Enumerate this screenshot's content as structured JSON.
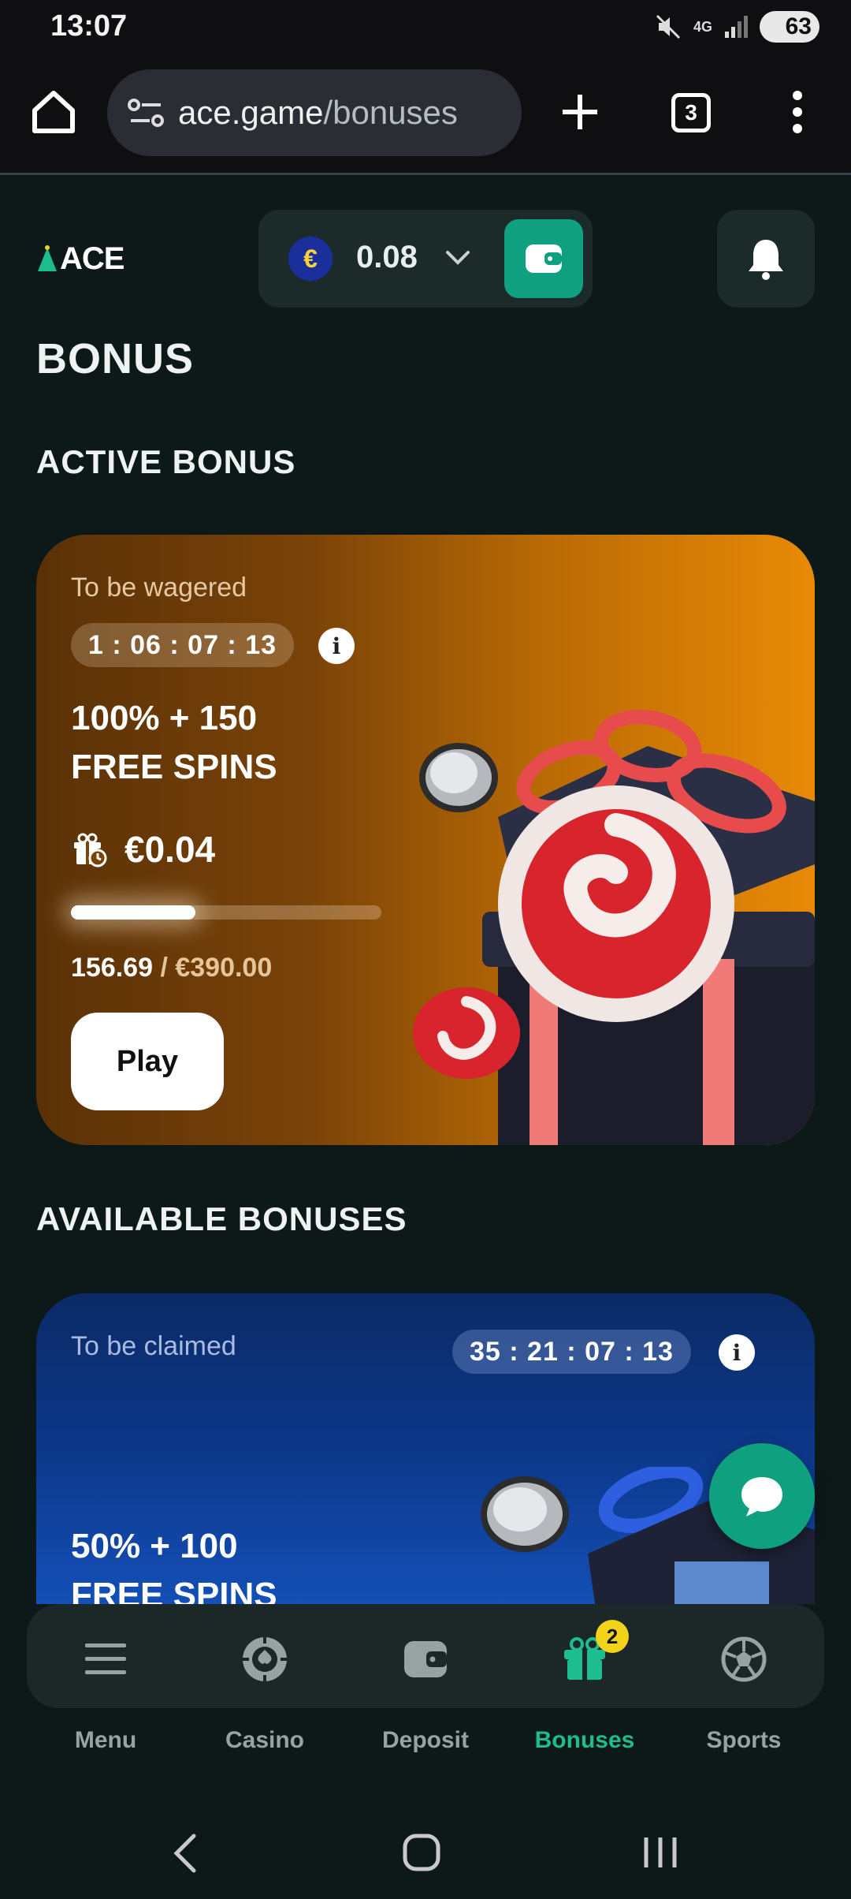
{
  "status_bar": {
    "time": "13:07",
    "network": "4G",
    "battery": "63"
  },
  "browser": {
    "url_host": "ace.game",
    "url_path": "/bonuses",
    "tab_count": "3"
  },
  "header": {
    "logo_text": "ACE",
    "currency_symbol": "€",
    "balance": "0.08"
  },
  "page": {
    "title": "BONUS",
    "active_heading": "ACTIVE BONUS",
    "available_heading": "AVAILABLE BONUSES"
  },
  "active_bonus": {
    "label": "To be wagered",
    "timer": "1 : 06 : 07 : 13",
    "title_line1": "100% + 150",
    "title_line2": "FREE SPINS",
    "amount": "€0.04",
    "progress_current": "156.69",
    "progress_total": " / €390.00",
    "progress_fraction": 0.402,
    "play_label": "Play"
  },
  "available_bonus": {
    "label": "To be claimed",
    "timer": "35 : 21 : 07 : 13",
    "title_line1": "50% + 100",
    "title_line2": "FREE SPINS"
  },
  "bottom_nav": {
    "items": [
      {
        "label": "Menu",
        "icon": "menu-icon"
      },
      {
        "label": "Casino",
        "icon": "casino-chip-icon"
      },
      {
        "label": "Deposit",
        "icon": "wallet-icon"
      },
      {
        "label": "Bonuses",
        "icon": "gift-icon",
        "badge": "2"
      },
      {
        "label": "Sports",
        "icon": "soccer-ball-icon"
      }
    ]
  },
  "colors": {
    "accent_green": "#0fa07f",
    "active_nav": "#1dbd90",
    "badge_yellow": "#f2d21b",
    "active_card_orange": "#e88a06",
    "available_card_blue": "#0d3a8e"
  }
}
